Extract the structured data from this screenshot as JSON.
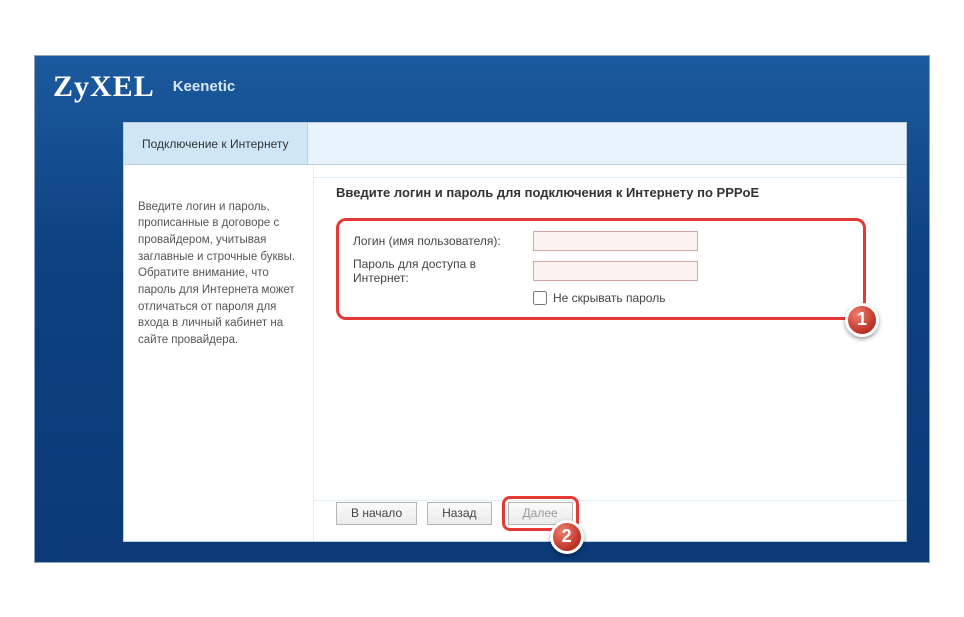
{
  "brand": {
    "logo": "ZyXEL",
    "product": "Keenetic"
  },
  "tabs": {
    "active": "Подключение к Интернету"
  },
  "sidebar": {
    "help_text": "Введите логин и пароль, прописанные в договоре с провайдером, учитывая заглавные и строчные буквы. Обратите внимание, что пароль для Интернета может отличаться от пароля для входа в личный кабинет на сайте провайдера."
  },
  "main": {
    "heading": "Введите логин и пароль для подключения к Интернету по PPPoE",
    "login_label": "Логин (имя пользователя):",
    "password_label": "Пароль для доступа в Интернет:",
    "show_password_label": "Не скрывать пароль",
    "login_value": "",
    "password_value": "",
    "show_password_checked": false
  },
  "buttons": {
    "home": "В начало",
    "back": "Назад",
    "next": "Далее"
  },
  "annotations": {
    "badge1": "1",
    "badge2": "2"
  },
  "colors": {
    "accent_red": "#e53935",
    "frame_blue": "#0d4180"
  }
}
